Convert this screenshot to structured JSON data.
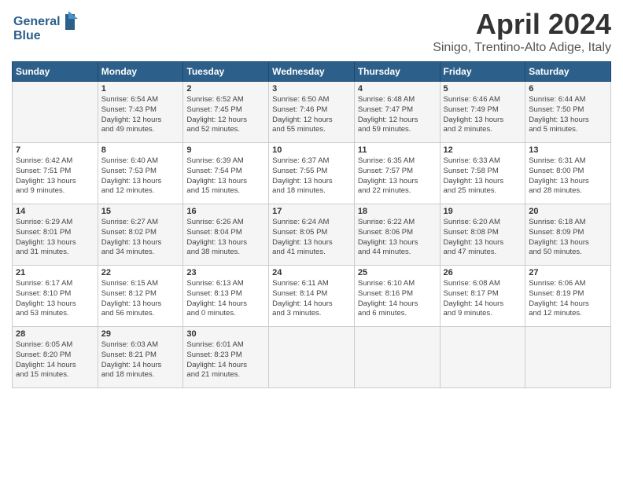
{
  "header": {
    "logo_line1": "General",
    "logo_line2": "Blue",
    "month_title": "April 2024",
    "location": "Sinigo, Trentino-Alto Adige, Italy"
  },
  "days_of_week": [
    "Sunday",
    "Monday",
    "Tuesday",
    "Wednesday",
    "Thursday",
    "Friday",
    "Saturday"
  ],
  "weeks": [
    [
      {
        "day": "",
        "info": ""
      },
      {
        "day": "1",
        "info": "Sunrise: 6:54 AM\nSunset: 7:43 PM\nDaylight: 12 hours\nand 49 minutes."
      },
      {
        "day": "2",
        "info": "Sunrise: 6:52 AM\nSunset: 7:45 PM\nDaylight: 12 hours\nand 52 minutes."
      },
      {
        "day": "3",
        "info": "Sunrise: 6:50 AM\nSunset: 7:46 PM\nDaylight: 12 hours\nand 55 minutes."
      },
      {
        "day": "4",
        "info": "Sunrise: 6:48 AM\nSunset: 7:47 PM\nDaylight: 12 hours\nand 59 minutes."
      },
      {
        "day": "5",
        "info": "Sunrise: 6:46 AM\nSunset: 7:49 PM\nDaylight: 13 hours\nand 2 minutes."
      },
      {
        "day": "6",
        "info": "Sunrise: 6:44 AM\nSunset: 7:50 PM\nDaylight: 13 hours\nand 5 minutes."
      }
    ],
    [
      {
        "day": "7",
        "info": "Sunrise: 6:42 AM\nSunset: 7:51 PM\nDaylight: 13 hours\nand 9 minutes."
      },
      {
        "day": "8",
        "info": "Sunrise: 6:40 AM\nSunset: 7:53 PM\nDaylight: 13 hours\nand 12 minutes."
      },
      {
        "day": "9",
        "info": "Sunrise: 6:39 AM\nSunset: 7:54 PM\nDaylight: 13 hours\nand 15 minutes."
      },
      {
        "day": "10",
        "info": "Sunrise: 6:37 AM\nSunset: 7:55 PM\nDaylight: 13 hours\nand 18 minutes."
      },
      {
        "day": "11",
        "info": "Sunrise: 6:35 AM\nSunset: 7:57 PM\nDaylight: 13 hours\nand 22 minutes."
      },
      {
        "day": "12",
        "info": "Sunrise: 6:33 AM\nSunset: 7:58 PM\nDaylight: 13 hours\nand 25 minutes."
      },
      {
        "day": "13",
        "info": "Sunrise: 6:31 AM\nSunset: 8:00 PM\nDaylight: 13 hours\nand 28 minutes."
      }
    ],
    [
      {
        "day": "14",
        "info": "Sunrise: 6:29 AM\nSunset: 8:01 PM\nDaylight: 13 hours\nand 31 minutes."
      },
      {
        "day": "15",
        "info": "Sunrise: 6:27 AM\nSunset: 8:02 PM\nDaylight: 13 hours\nand 34 minutes."
      },
      {
        "day": "16",
        "info": "Sunrise: 6:26 AM\nSunset: 8:04 PM\nDaylight: 13 hours\nand 38 minutes."
      },
      {
        "day": "17",
        "info": "Sunrise: 6:24 AM\nSunset: 8:05 PM\nDaylight: 13 hours\nand 41 minutes."
      },
      {
        "day": "18",
        "info": "Sunrise: 6:22 AM\nSunset: 8:06 PM\nDaylight: 13 hours\nand 44 minutes."
      },
      {
        "day": "19",
        "info": "Sunrise: 6:20 AM\nSunset: 8:08 PM\nDaylight: 13 hours\nand 47 minutes."
      },
      {
        "day": "20",
        "info": "Sunrise: 6:18 AM\nSunset: 8:09 PM\nDaylight: 13 hours\nand 50 minutes."
      }
    ],
    [
      {
        "day": "21",
        "info": "Sunrise: 6:17 AM\nSunset: 8:10 PM\nDaylight: 13 hours\nand 53 minutes."
      },
      {
        "day": "22",
        "info": "Sunrise: 6:15 AM\nSunset: 8:12 PM\nDaylight: 13 hours\nand 56 minutes."
      },
      {
        "day": "23",
        "info": "Sunrise: 6:13 AM\nSunset: 8:13 PM\nDaylight: 14 hours\nand 0 minutes."
      },
      {
        "day": "24",
        "info": "Sunrise: 6:11 AM\nSunset: 8:14 PM\nDaylight: 14 hours\nand 3 minutes."
      },
      {
        "day": "25",
        "info": "Sunrise: 6:10 AM\nSunset: 8:16 PM\nDaylight: 14 hours\nand 6 minutes."
      },
      {
        "day": "26",
        "info": "Sunrise: 6:08 AM\nSunset: 8:17 PM\nDaylight: 14 hours\nand 9 minutes."
      },
      {
        "day": "27",
        "info": "Sunrise: 6:06 AM\nSunset: 8:19 PM\nDaylight: 14 hours\nand 12 minutes."
      }
    ],
    [
      {
        "day": "28",
        "info": "Sunrise: 6:05 AM\nSunset: 8:20 PM\nDaylight: 14 hours\nand 15 minutes."
      },
      {
        "day": "29",
        "info": "Sunrise: 6:03 AM\nSunset: 8:21 PM\nDaylight: 14 hours\nand 18 minutes."
      },
      {
        "day": "30",
        "info": "Sunrise: 6:01 AM\nSunset: 8:23 PM\nDaylight: 14 hours\nand 21 minutes."
      },
      {
        "day": "",
        "info": ""
      },
      {
        "day": "",
        "info": ""
      },
      {
        "day": "",
        "info": ""
      },
      {
        "day": "",
        "info": ""
      }
    ]
  ]
}
